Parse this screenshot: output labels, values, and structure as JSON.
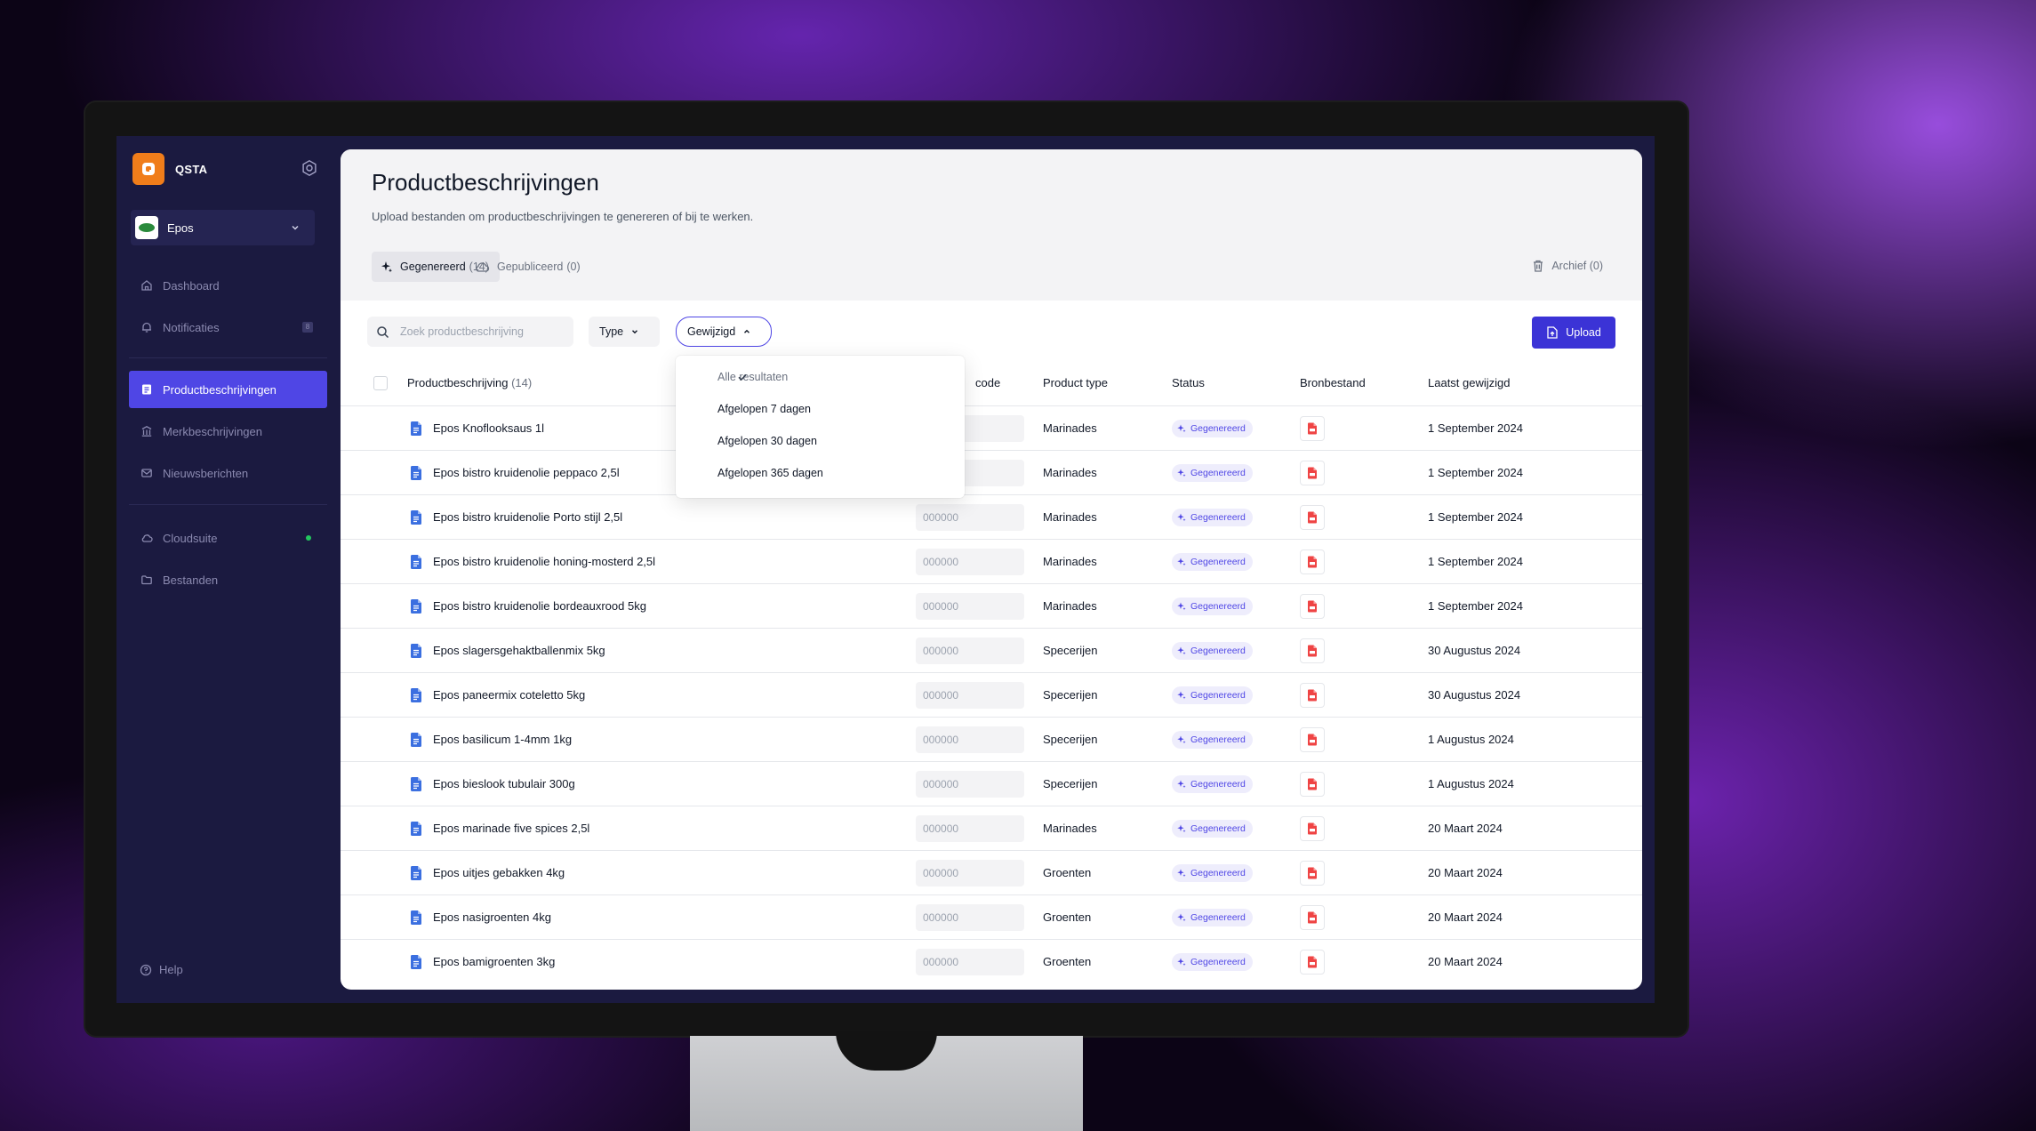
{
  "brand": {
    "name": "QSTA",
    "logo_color": "#f07d1a"
  },
  "org": {
    "name": "Epos"
  },
  "sidebar": {
    "items": [
      {
        "label": "Dashboard",
        "icon": "home-icon"
      },
      {
        "label": "Notificaties",
        "icon": "bell-icon",
        "badge": "8"
      },
      {
        "label": "Productbeschrijvingen",
        "icon": "document-icon",
        "active": true
      },
      {
        "label": "Merkbeschrijvingen",
        "icon": "building-icon"
      },
      {
        "label": "Nieuwsberichten",
        "icon": "mail-icon"
      },
      {
        "label": "Cloudsuite",
        "icon": "cloud-icon",
        "status": "connected"
      },
      {
        "label": "Bestanden",
        "icon": "folder-icon"
      }
    ],
    "help_label": "Help"
  },
  "header": {
    "title": "Productbeschrijvingen",
    "subtitle": "Upload bestanden om productbeschrijvingen te genereren of bij te werken."
  },
  "tabs": [
    {
      "label": "Gegenereerd",
      "count": "(14)",
      "active": true
    },
    {
      "label": "Gepubliceerd",
      "count": "(0)"
    }
  ],
  "archive": {
    "label": "Archief (0)"
  },
  "toolbar": {
    "search_placeholder": "Zoek productbeschrijving",
    "type_label": "Type",
    "modified_label": "Gewijzigd",
    "upload_label": "Upload"
  },
  "dropdown": {
    "options": [
      "Alle resultaten",
      "Afgelopen 7 dagen",
      "Afgelopen 30 dagen",
      "Afgelopen 365 dagen"
    ],
    "selected": "Alle resultaten"
  },
  "table": {
    "columns": {
      "name": "Productbeschrijving",
      "name_count": "(14)",
      "code": "code",
      "ptype": "Product type",
      "status": "Status",
      "source": "Bronbestand",
      "modified": "Laatst gewijzigd"
    },
    "rows": [
      {
        "name": "Epos Knoflooksaus 1l",
        "code": "",
        "ptype": "Marinades",
        "status": "Gegenereerd",
        "date": "1 September 2024"
      },
      {
        "name": "Epos bistro kruidenolie peppaco 2,5l",
        "code": "",
        "ptype": "Marinades",
        "status": "Gegenereerd",
        "date": "1 September 2024"
      },
      {
        "name": "Epos bistro kruidenolie Porto stijl 2,5l",
        "code": "000000",
        "ptype": "Marinades",
        "status": "Gegenereerd",
        "date": "1 September 2024"
      },
      {
        "name": "Epos bistro kruidenolie honing-mosterd 2,5l",
        "code": "000000",
        "ptype": "Marinades",
        "status": "Gegenereerd",
        "date": "1 September 2024"
      },
      {
        "name": "Epos bistro kruidenolie bordeauxrood 5kg",
        "code": "000000",
        "ptype": "Marinades",
        "status": "Gegenereerd",
        "date": "1 September 2024"
      },
      {
        "name": "Epos slagersgehaktballenmix 5kg",
        "code": "000000",
        "ptype": "Specerijen",
        "status": "Gegenereerd",
        "date": "30 Augustus 2024"
      },
      {
        "name": "Epos paneermix coteletto 5kg",
        "code": "000000",
        "ptype": "Specerijen",
        "status": "Gegenereerd",
        "date": "30 Augustus 2024"
      },
      {
        "name": "Epos basilicum 1-4mm 1kg",
        "code": "000000",
        "ptype": "Specerijen",
        "status": "Gegenereerd",
        "date": "1 Augustus 2024"
      },
      {
        "name": "Epos bieslook tubulair 300g",
        "code": "000000",
        "ptype": "Specerijen",
        "status": "Gegenereerd",
        "date": "1 Augustus 2024"
      },
      {
        "name": "Epos marinade five spices 2,5l",
        "code": "000000",
        "ptype": "Marinades",
        "status": "Gegenereerd",
        "date": "20 Maart 2024"
      },
      {
        "name": "Epos uitjes gebakken 4kg",
        "code": "000000",
        "ptype": "Groenten",
        "status": "Gegenereerd",
        "date": "20 Maart 2024"
      },
      {
        "name": "Epos nasigroenten 4kg",
        "code": "000000",
        "ptype": "Groenten",
        "status": "Gegenereerd",
        "date": "20 Maart 2024"
      },
      {
        "name": "Epos bamigroenten 3kg",
        "code": "000000",
        "ptype": "Groenten",
        "status": "Gegenereerd",
        "date": "20 Maart 2024"
      }
    ]
  },
  "colors": {
    "accent": "#4f46e5",
    "upload_button": "#3b33d6",
    "sidebar_bg": "#1b1a40",
    "pdf_red": "#ef4444",
    "doc_blue": "#3b6fe0"
  }
}
